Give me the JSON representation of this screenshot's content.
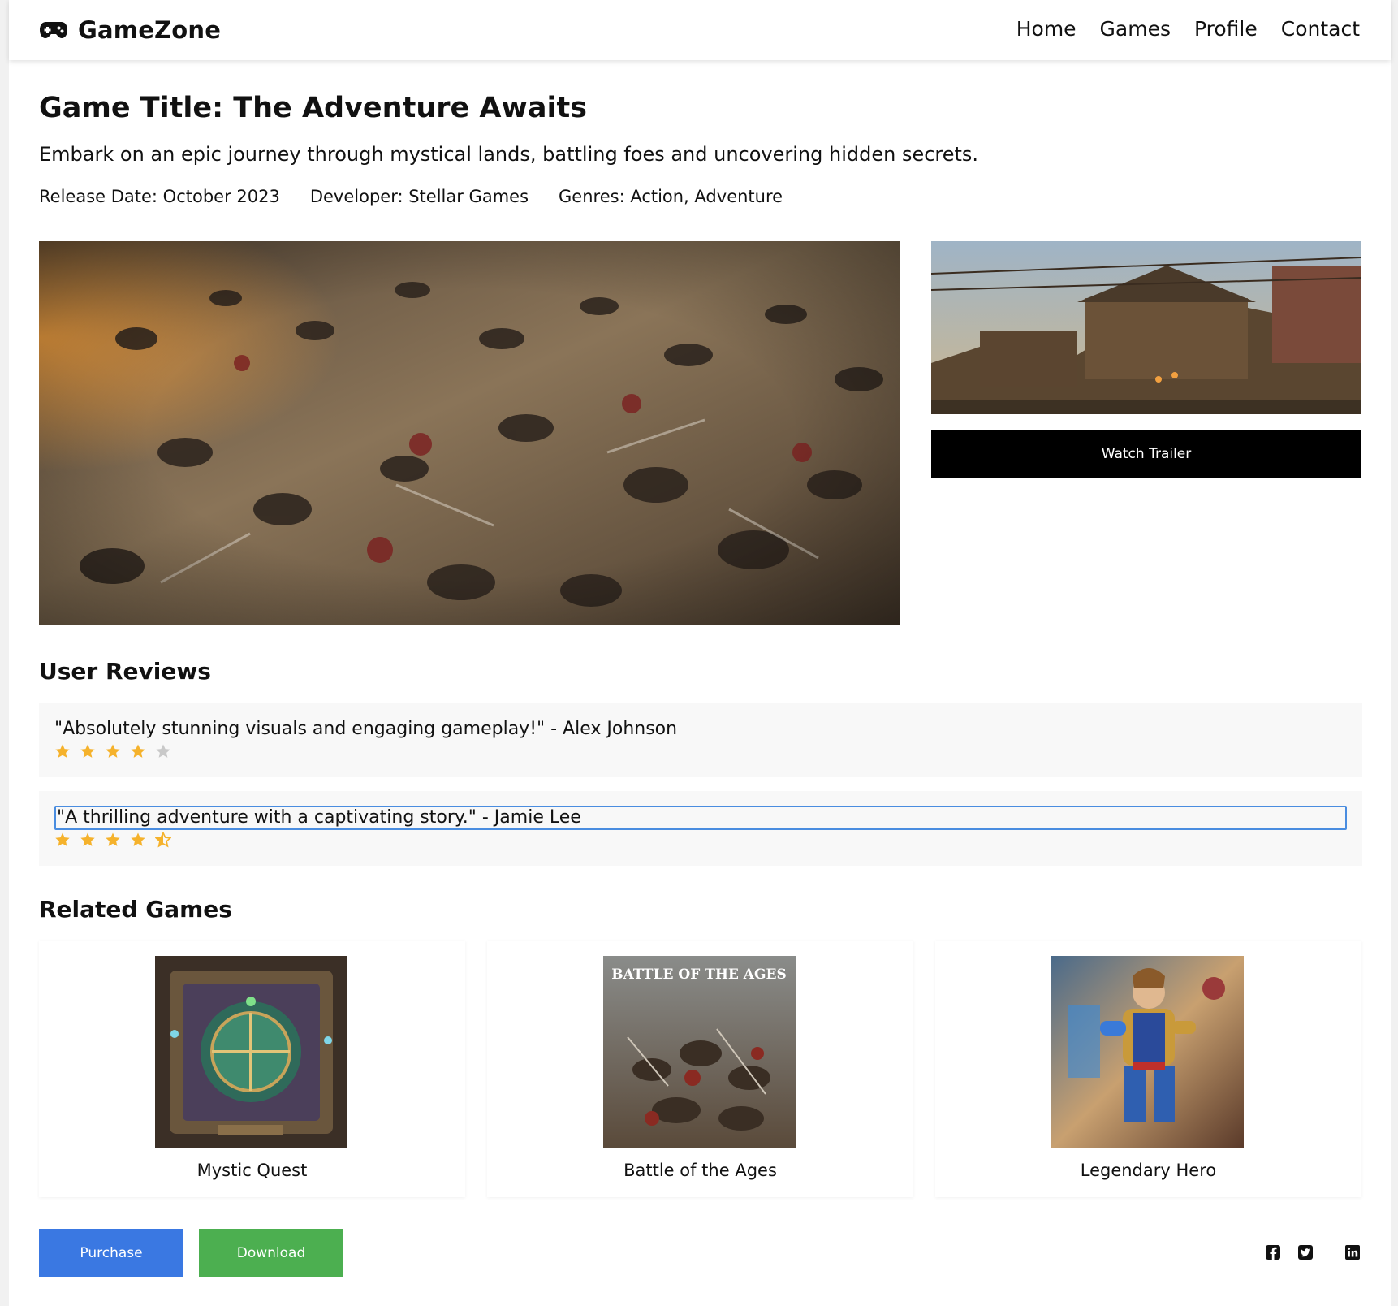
{
  "brand": {
    "name": "GameZone",
    "icon": "gamepad-icon"
  },
  "nav": {
    "links": [
      {
        "label": "Home"
      },
      {
        "label": "Games"
      },
      {
        "label": "Profile"
      },
      {
        "label": "Contact"
      }
    ]
  },
  "game": {
    "title": "Game Title: The Adventure Awaits",
    "description": "Embark on an epic journey through mystical lands, battling foes and uncovering hidden secrets.",
    "release": "Release Date: October 2023",
    "developer": "Developer: Stellar Games",
    "genres": "Genres: Action, Adventure",
    "trailer_label": "Watch Trailer"
  },
  "reviews": {
    "heading": "User Reviews",
    "items": [
      {
        "text": "\"Absolutely stunning visuals and engaging gameplay!\" - Alex Johnson",
        "rating": 4,
        "max": 5,
        "selected": false
      },
      {
        "text": "\"A thrilling adventure with a captivating story.\" - Jamie Lee",
        "rating": 4.5,
        "max": 5,
        "selected": true
      }
    ]
  },
  "related": {
    "heading": "Related Games",
    "games": [
      {
        "name": "Mystic Quest"
      },
      {
        "name": "Battle of the Ages",
        "cover_text": "BATTLE OF THE AGES"
      },
      {
        "name": "Legendary Hero"
      }
    ]
  },
  "actions": {
    "purchase": "Purchase",
    "download": "Download"
  },
  "social": [
    "facebook-icon",
    "twitter-icon",
    "linkedin-icon"
  ],
  "colors": {
    "purchase": "#3a78e2",
    "download": "#4caf50",
    "star_filled": "#f5b22c",
    "star_empty": "#c9c9c9",
    "selection_outline": "#4a8de0"
  }
}
